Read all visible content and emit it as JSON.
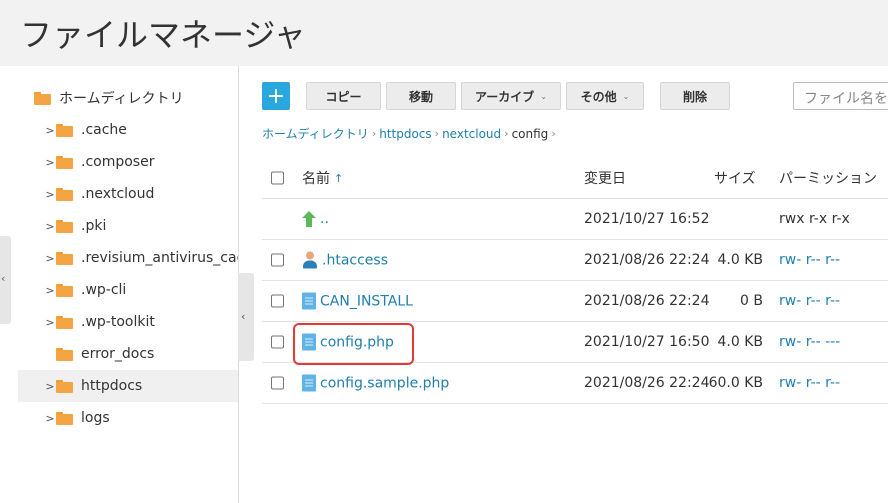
{
  "header": {
    "title": "ファイルマネージャ"
  },
  "sidebar": {
    "root": "ホームディレクトリ",
    "items": [
      {
        "label": ".cache"
      },
      {
        "label": ".composer"
      },
      {
        "label": ".nextcloud"
      },
      {
        "label": ".pki"
      },
      {
        "label": ".revisium_antivirus_cache"
      },
      {
        "label": ".wp-cli"
      },
      {
        "label": ".wp-toolkit"
      },
      {
        "label": "error_docs"
      },
      {
        "label": "httpdocs",
        "selected": true
      },
      {
        "label": "logs"
      }
    ]
  },
  "toolbar": {
    "add_label": "+",
    "copy_label": "コピー",
    "move_label": "移動",
    "archive_label": "アーカイブ",
    "other_label": "その他",
    "delete_label": "削除",
    "search_placeholder": "ファイル名を検索"
  },
  "breadcrumb": {
    "items": [
      "ホームディレクトリ",
      "httpdocs",
      "nextcloud"
    ],
    "current": "config"
  },
  "table": {
    "headers": {
      "name": "名前",
      "sort_arrow": "↑",
      "date": "変更日",
      "size": "サイズ",
      "perm": "パーミッション"
    },
    "rows": [
      {
        "name": "..",
        "date": "2021/10/27 16:52",
        "size": "",
        "perm": "rwx r-x r-x",
        "icon": "parent-dir-icon"
      },
      {
        "name": ".htaccess",
        "date": "2021/08/26 22:24",
        "size": "4.0 KB",
        "perm": "rw- r-- r--",
        "icon": "user-file-icon"
      },
      {
        "name": "CAN_INSTALL",
        "date": "2021/08/26 22:24",
        "size": "0 B",
        "perm": "rw- r-- r--",
        "icon": "document-icon"
      },
      {
        "name": "config.php",
        "date": "2021/10/27 16:50",
        "size": "4.0 KB",
        "perm": "rw- r-- ---",
        "icon": "document-icon",
        "highlighted": true
      },
      {
        "name": "config.sample.php",
        "date": "2021/08/26 22:24",
        "size": "60.0 KB",
        "perm": "rw- r-- r--",
        "icon": "document-icon"
      }
    ]
  },
  "colors": {
    "accent": "#2aa7dc",
    "link": "#1f7fad",
    "folder": "#f5a443",
    "highlight": "#e53935"
  }
}
